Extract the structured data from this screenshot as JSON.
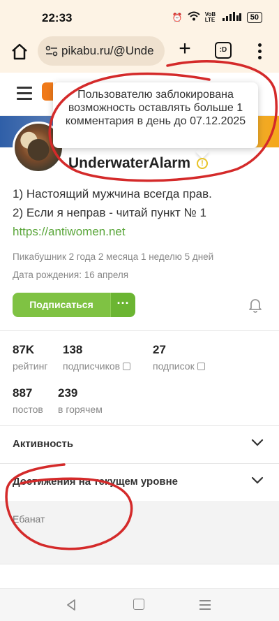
{
  "status_bar": {
    "time": "22:33",
    "battery": "50",
    "network": "VoB LTE",
    "icons": [
      "alarm-icon",
      "wifi-icon",
      "signal-icon",
      "battery-icon"
    ]
  },
  "browser": {
    "url": "pikabu.ru/@Unde",
    "tabs_label": ":D"
  },
  "tooltip": {
    "text": "Пользователю заблокирована возможность оставлять больше 1 комментария в день до 07.12.2025"
  },
  "profile": {
    "username": "UnderwaterAlarm",
    "bio_line1": "1) Настоящий мужчина всегда прав.",
    "bio_line2": "2) Если я неправ - читай пункт № 1",
    "bio_link": "https://antiwomen.net",
    "tenure": "Пикабушник 2 года 2 месяца 1 неделю 5 дней",
    "birthday": "Дата рождения: 16 апреля",
    "subscribe_label": "Подписаться",
    "more_label": "···"
  },
  "stats": {
    "rating_value": "87K",
    "rating_label": "рейтинг",
    "followers_value": "138",
    "followers_label": "подписчиков",
    "following_value": "27",
    "following_label": "подписок",
    "posts_value": "887",
    "posts_label": "постов",
    "hot_value": "239",
    "hot_label": "в горячем"
  },
  "sections": {
    "activity": "Активность",
    "achievements": "Достижения на текущем уровне",
    "achievement_text": "Ебанат"
  },
  "colors": {
    "accent_green": "#7fc243",
    "scribble_red": "#d42a2a"
  }
}
